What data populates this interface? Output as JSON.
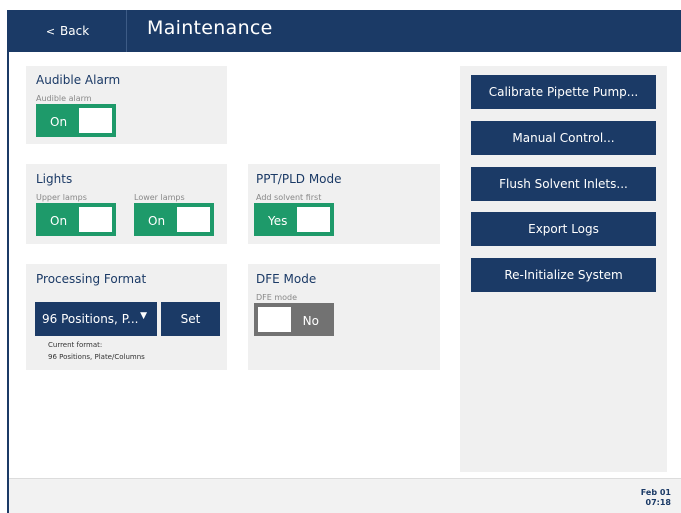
{
  "header": {
    "back_label": "Back",
    "title": "Maintenance"
  },
  "audible_alarm": {
    "title": "Audible Alarm",
    "label": "Audible alarm",
    "state": "On"
  },
  "lights": {
    "title": "Lights",
    "upper_label": "Upper lamps",
    "upper_state": "On",
    "lower_label": "Lower lamps",
    "lower_state": "On"
  },
  "ppt_pld": {
    "title": "PPT/PLD Mode",
    "label": "Add solvent first",
    "state": "Yes"
  },
  "processing_format": {
    "title": "Processing Format",
    "selected": "96 Positions, P...",
    "set_label": "Set",
    "current_label": "Current format:",
    "current_value": "96 Positions, Plate/Columns"
  },
  "dfe": {
    "title": "DFE Mode",
    "label": "DFE mode",
    "state": "No"
  },
  "actions": [
    "Calibrate Pipette Pump...",
    "Manual Control...",
    "Flush Solvent Inlets...",
    "Export Logs",
    "Re-Initialize System"
  ],
  "footer": {
    "date": "Feb 01",
    "time": "07:18"
  },
  "colors": {
    "primary": "#1b3a66",
    "toggle_on": "#1e9a6a",
    "toggle_off": "#727272",
    "panel": "#f0f0f0"
  }
}
